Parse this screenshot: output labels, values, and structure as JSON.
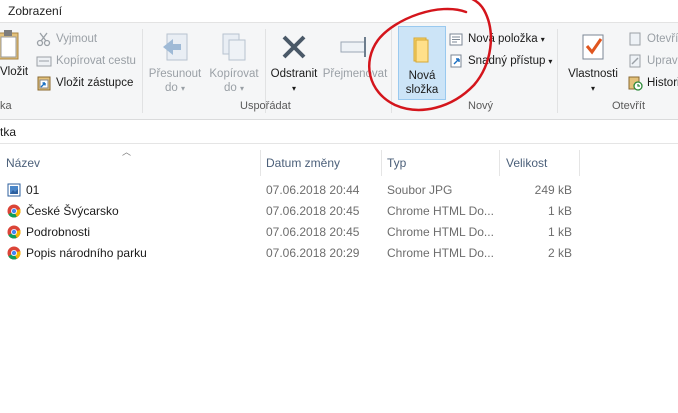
{
  "tabs": {
    "view_label": "Zobrazení"
  },
  "clipboard": {
    "cut_label": "Vyjmout",
    "copy_path_label": "Kopírovat cestu",
    "paste_shortcut_label": "Vložit zástupce",
    "paste_label": "Vložit",
    "group_label": "ka"
  },
  "organize": {
    "move_to_line1": "Přesunout",
    "move_to_line2": "do",
    "copy_to_line1": "Kopírovat",
    "copy_to_line2": "do",
    "delete_label": "Odstranit",
    "rename_label": "Přejmenovat",
    "group_label": "Uspořádat"
  },
  "new": {
    "new_folder_line1": "Nová",
    "new_folder_line2": "složka",
    "new_item_label": "Nová položka",
    "easy_access_label": "Snadný přístup",
    "group_label": "Nový"
  },
  "open": {
    "properties_label": "Vlastnosti",
    "open_label": "Otevřít",
    "edit_label": "Upravit",
    "history_label": "Historie",
    "group_label": "Otevřít"
  },
  "address": {
    "text": "tka"
  },
  "columns": {
    "name": "Název",
    "date": "Datum změny",
    "type": "Typ",
    "size": "Velikost"
  },
  "files": [
    {
      "name": "01",
      "date": "07.06.2018 20:44",
      "type": "Soubor JPG",
      "size": "249 kB",
      "icon": "image-file-icon"
    },
    {
      "name": "České Švýcarsko",
      "date": "07.06.2018 20:45",
      "type": "Chrome HTML Do...",
      "size": "1 kB",
      "icon": "chrome-icon"
    },
    {
      "name": "Podrobnosti",
      "date": "07.06.2018 20:45",
      "type": "Chrome HTML Do...",
      "size": "1 kB",
      "icon": "chrome-icon"
    },
    {
      "name": "Popis národního parku",
      "date": "07.06.2018 20:29",
      "type": "Chrome HTML Do...",
      "size": "2 kB",
      "icon": "chrome-icon"
    }
  ],
  "colors": {
    "selection_bg": "#cce4f7",
    "annotation_red": "#d4151c",
    "header_text": "#4c607a"
  }
}
